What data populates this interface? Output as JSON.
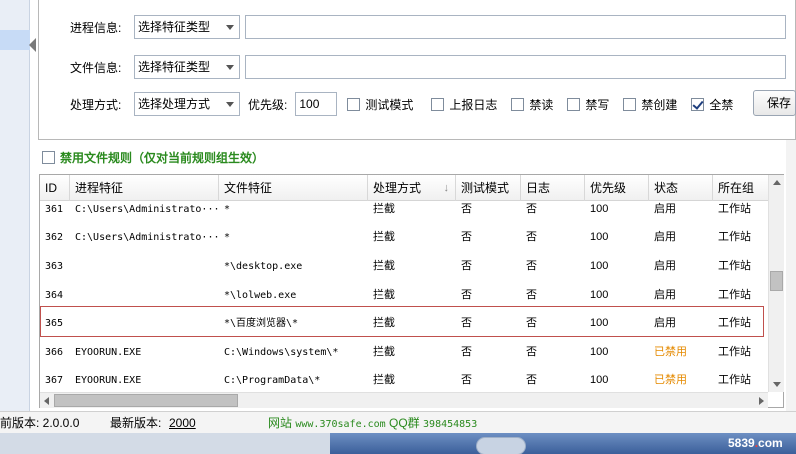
{
  "form": {
    "process_label": "进程信息:",
    "process_select": "选择特征类型",
    "file_label": "文件信息:",
    "file_select": "选择特征类型",
    "action_label": "处理方式:",
    "action_select": "选择处理方式",
    "priority_label": "优先级:",
    "priority_value": "100",
    "options": [
      {
        "label": "测试模式",
        "checked": false
      },
      {
        "label": "上报日志",
        "checked": false
      },
      {
        "label": "禁读",
        "checked": false
      },
      {
        "label": "禁写",
        "checked": false
      },
      {
        "label": "禁创建",
        "checked": false
      },
      {
        "label": "全禁",
        "checked": true
      }
    ],
    "save_label": "保存"
  },
  "rule_toggle": {
    "label": "禁用文件规则（仅对当前规则组生效）",
    "checked": false
  },
  "table": {
    "columns": [
      "ID",
      "进程特征",
      "文件特征",
      "处理方式",
      "测试模式",
      "日志",
      "优先级",
      "状态",
      "所在组"
    ],
    "rows": [
      {
        "id": "361",
        "process": "C:\\Users\\Administrato···",
        "file": "*",
        "action": "拦截",
        "test": "否",
        "log": "否",
        "priority": "100",
        "status": "启用",
        "group": "工作站"
      },
      {
        "id": "362",
        "process": "C:\\Users\\Administrato···",
        "file": "*",
        "action": "拦截",
        "test": "否",
        "log": "否",
        "priority": "100",
        "status": "启用",
        "group": "工作站"
      },
      {
        "id": "363",
        "process": "",
        "file": "*\\desktop.exe",
        "action": "拦截",
        "test": "否",
        "log": "否",
        "priority": "100",
        "status": "启用",
        "group": "工作站"
      },
      {
        "id": "364",
        "process": "",
        "file": "*\\lolweb.exe",
        "action": "拦截",
        "test": "否",
        "log": "否",
        "priority": "100",
        "status": "启用",
        "group": "工作站"
      },
      {
        "id": "365",
        "process": "",
        "file": "*\\百度浏览器\\*",
        "action": "拦截",
        "test": "否",
        "log": "否",
        "priority": "100",
        "status": "启用",
        "group": "工作站"
      },
      {
        "id": "366",
        "process": "EYOORUN.EXE",
        "file": "C:\\Windows\\system\\*",
        "action": "拦截",
        "test": "否",
        "log": "否",
        "priority": "100",
        "status": "已禁用",
        "group": "工作站"
      },
      {
        "id": "367",
        "process": "EYOORUN.EXE",
        "file": "C:\\ProgramData\\*",
        "action": "拦截",
        "test": "否",
        "log": "否",
        "priority": "100",
        "status": "已禁用",
        "group": "工作站"
      }
    ]
  },
  "status_bar": {
    "current_version": "前版本: 2.0.0.0",
    "latest_label": "最新版本:",
    "latest_value": "2000",
    "site_prefix": "网站",
    "site_url": "www.370safe.com",
    "qq_label": "QQ群",
    "qq_number": "398454853"
  },
  "watermark": {
    "prefix": "5839",
    "suffix": "com"
  },
  "colors": {
    "rule_green": "#2a8a1e",
    "disabled_orange": "#e58a00",
    "selection_border": "#c0504d"
  }
}
